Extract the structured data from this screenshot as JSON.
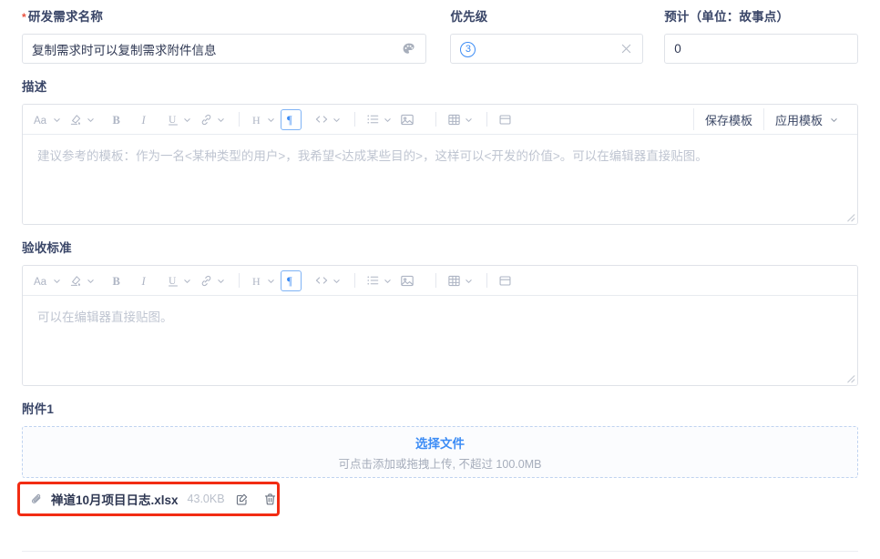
{
  "form": {
    "name_field": {
      "label": "研发需求名称",
      "required_marker": "*",
      "value": "复制需求时可以复制需求附件信息",
      "trailing_icon": "palette-icon"
    },
    "priority_field": {
      "label": "优先级",
      "value": "3",
      "clear_icon": "close-icon"
    },
    "estimate_field": {
      "label": "预计（单位：故事点）",
      "value": "0"
    }
  },
  "description": {
    "label": "描述",
    "placeholder": "建议参考的模板：作为一名<某种类型的用户>，我希望<达成某些目的>，这样可以<开发的价值>。可以在编辑器直接贴图。",
    "save_template_label": "保存模板",
    "apply_template_label": "应用模板"
  },
  "acceptance": {
    "label": "验收标准",
    "placeholder": "可以在编辑器直接贴图。"
  },
  "toolbar_items": [
    {
      "name": "font-size-icon",
      "glyph": "Aa",
      "dropdown": true
    },
    {
      "name": "text-color-icon",
      "glyph": "paint",
      "dropdown": true
    },
    {
      "name": "bold-icon",
      "glyph": "B",
      "dropdown": false
    },
    {
      "name": "italic-icon",
      "glyph": "I",
      "dropdown": false
    },
    {
      "name": "underline-icon",
      "glyph": "U",
      "dropdown": true
    },
    {
      "name": "link-icon",
      "glyph": "link",
      "dropdown": true
    },
    {
      "name": "heading-icon",
      "glyph": "H",
      "dropdown": true
    },
    {
      "name": "paragraph-icon",
      "glyph": "¶",
      "dropdown": false,
      "active": true
    },
    {
      "name": "code-icon",
      "glyph": "<>",
      "dropdown": true
    },
    {
      "name": "bullet-list-icon",
      "glyph": "list",
      "dropdown": true
    },
    {
      "name": "image-icon",
      "glyph": "image",
      "dropdown": false
    },
    {
      "name": "table-icon",
      "glyph": "table",
      "dropdown": true
    },
    {
      "name": "card-icon",
      "glyph": "card",
      "dropdown": false
    }
  ],
  "attachment": {
    "label": "附件1",
    "select_file_label": "选择文件",
    "hint": "可点击添加或拖拽上传, 不超过 100.0MB",
    "file": {
      "icon": "paperclip-icon",
      "name": "禅道10月项目日志.xlsx",
      "size": "43.0KB",
      "edit_icon": "edit-icon",
      "delete_icon": "trash-icon"
    },
    "highlight_color": "#f22c13"
  },
  "colors": {
    "accent": "#3c8cf5",
    "required": "#e8523f",
    "label": "#3a4668",
    "border": "#dfe2e8",
    "placeholder": "#bfc5d1"
  }
}
